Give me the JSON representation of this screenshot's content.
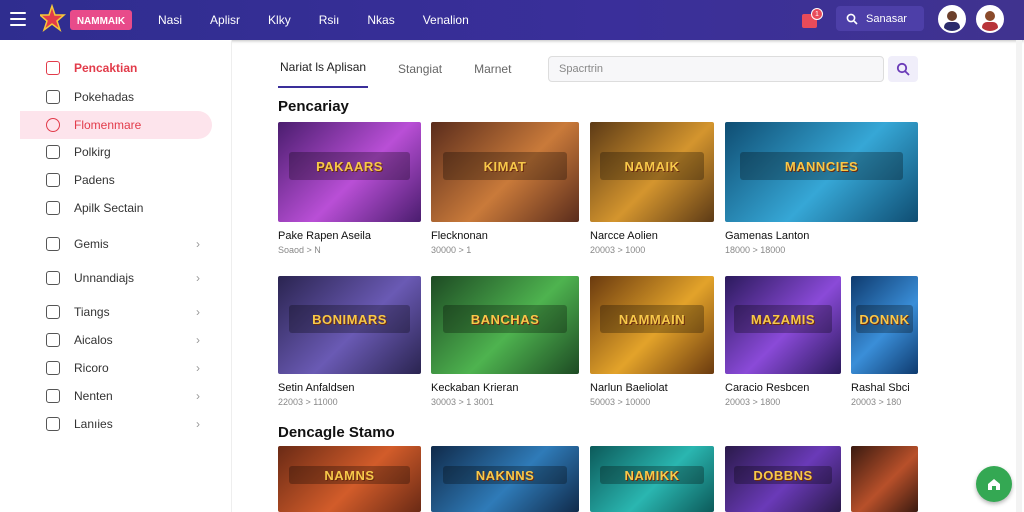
{
  "header": {
    "logo_text": "NAMMAIK",
    "nav": [
      "Nasi",
      "Aplisr",
      "Klky",
      "Rsiı",
      "Nkas",
      "Venalion"
    ],
    "cart_count": "1",
    "search_button_label": "Sanasar"
  },
  "sidebar": {
    "items": [
      {
        "label": "Pencaktian",
        "icon": "store-icon",
        "state": "active",
        "chevron": false
      },
      {
        "label": "Pokehadas",
        "icon": "chat-icon",
        "state": "normal",
        "chevron": false
      },
      {
        "label": "Flomenmare",
        "icon": "pen-icon",
        "state": "highlighted",
        "chevron": false
      },
      {
        "label": "Polkirg",
        "icon": "list-icon",
        "state": "normal",
        "chevron": false
      },
      {
        "label": "Padens",
        "icon": "image-icon",
        "state": "normal",
        "chevron": false
      },
      {
        "label": "Apilk Sectain",
        "icon": "book-icon",
        "state": "normal",
        "chevron": false
      },
      {
        "label": "Gemis",
        "icon": "gamepad-icon",
        "state": "normal",
        "chevron": true
      },
      {
        "label": "Unnandiajs",
        "icon": "circle-icon",
        "state": "normal",
        "chevron": true
      },
      {
        "label": "Tiangs",
        "icon": "gift-icon",
        "state": "normal",
        "chevron": true
      },
      {
        "label": "Aicalos",
        "icon": "bar-icon",
        "state": "normal",
        "chevron": true
      },
      {
        "label": "Ricoro",
        "icon": "grid-icon",
        "state": "normal",
        "chevron": true
      },
      {
        "label": "Nenten",
        "icon": "box-icon",
        "state": "normal",
        "chevron": true
      },
      {
        "label": "Lanıies",
        "icon": "building-icon",
        "state": "normal",
        "chevron": true
      }
    ]
  },
  "tabs": [
    "Nariat  ls  Aplisan",
    "Stangiat",
    "Marnet"
  ],
  "search": {
    "placeholder": "Spacrtrin"
  },
  "sections": [
    {
      "title": "Pencariay",
      "cards": [
        {
          "title": "Pake Rapen Aseila",
          "meta": "Soaod > N",
          "banner": "PAKAARS",
          "colors": [
            "#4a1d6e",
            "#b94fd6"
          ]
        },
        {
          "title": "Flecknonan",
          "meta": "30000 > 1",
          "banner": "KIMAT",
          "colors": [
            "#5a2c1c",
            "#c97a3a"
          ]
        },
        {
          "title": "Narcce Aolien",
          "meta": "20003 > 1000",
          "banner": "NAMAIK",
          "colors": [
            "#5c3a16",
            "#d4952e"
          ]
        },
        {
          "title": "Gamenas Lanton",
          "meta": "18000 > 18000",
          "banner": "MANNCIES",
          "colors": [
            "#0f4d72",
            "#36a7d6"
          ]
        }
      ]
    },
    {
      "title": "",
      "cards": [
        {
          "title": "Setin Anfaldsen",
          "meta": "22003 > 11000",
          "banner": "BONIMARS",
          "colors": [
            "#2a2450",
            "#6a5ab4"
          ]
        },
        {
          "title": "Keckaban Krieran",
          "meta": "30003 > 1 3001",
          "banner": "BANCHAS",
          "colors": [
            "#1d4a23",
            "#4eb34f"
          ]
        },
        {
          "title": "Narlun Baeliolat",
          "meta": "50003 > 10000",
          "banner": "NAMMAIN",
          "colors": [
            "#6a3a0f",
            "#e3a32a"
          ]
        },
        {
          "title": "Caracio Resbcen",
          "meta": "20003 > 1800",
          "banner": "MAZAMIS",
          "colors": [
            "#2b1a5c",
            "#8a4ad8"
          ]
        },
        {
          "title": "Rashal Sbci",
          "meta": "20003 > 180",
          "banner": "DONNK",
          "colors": [
            "#0e3a6e",
            "#3a8ed8"
          ]
        }
      ]
    },
    {
      "title": "Dencagle Stamo",
      "cards": [
        {
          "title": "",
          "meta": "",
          "banner": "NAMNS",
          "colors": [
            "#6a2a15",
            "#d25c2a"
          ]
        },
        {
          "title": "",
          "meta": "",
          "banner": "NAKNNS",
          "colors": [
            "#102a4a",
            "#2f7bb8"
          ]
        },
        {
          "title": "",
          "meta": "",
          "banner": "NAMIKK",
          "colors": [
            "#0c5a5a",
            "#2ab6b0"
          ]
        },
        {
          "title": "",
          "meta": "",
          "banner": "DOBBNS",
          "colors": [
            "#2a1a4a",
            "#6a3ab8"
          ]
        },
        {
          "title": "",
          "meta": "",
          "banner": "",
          "colors": [
            "#3a1a10",
            "#b8502a"
          ]
        }
      ]
    }
  ],
  "colors": {
    "accent": "#e23b4a",
    "brand": "#3a2f9a",
    "fab": "#34a853"
  }
}
